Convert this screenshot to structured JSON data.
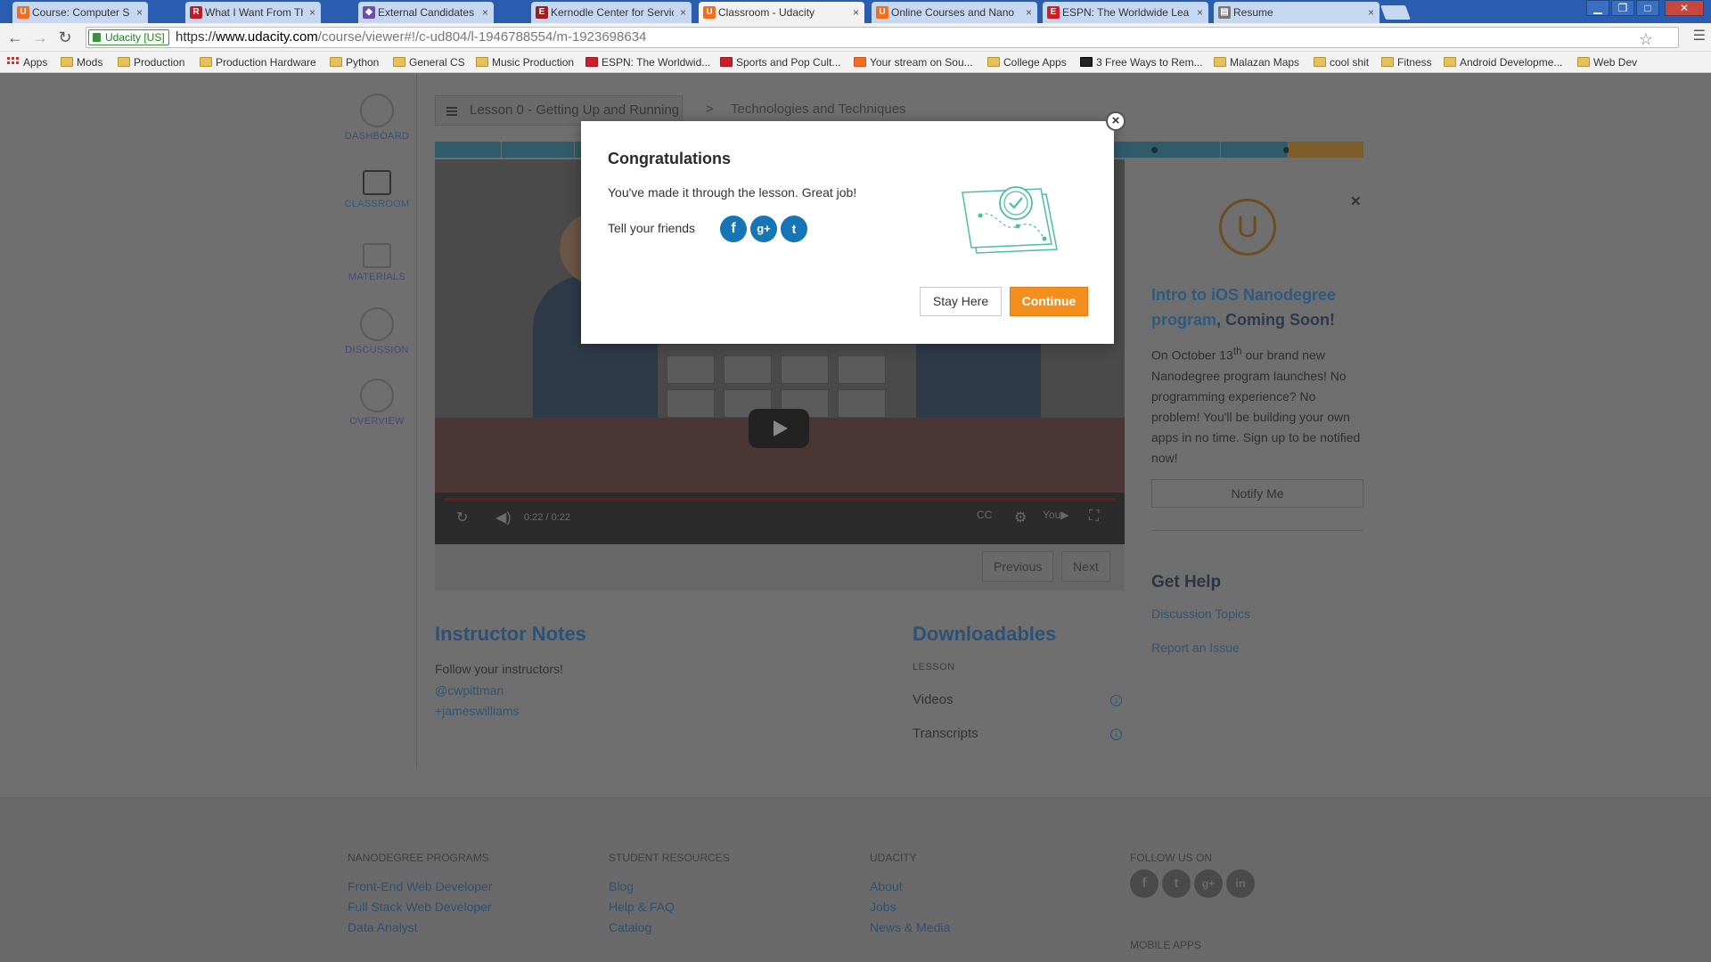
{
  "browser": {
    "tabs": [
      {
        "title": "Course: Computer Science",
        "favicon": "orange-u",
        "active": false
      },
      {
        "title": "What I Want From The Ne",
        "favicon": "red-r",
        "active": false
      },
      {
        "title": "External Candidates Gate",
        "favicon": "purple-diamond",
        "active": false
      },
      {
        "title": "Kernodle Center for Servic",
        "favicon": "e-letter",
        "active": false
      },
      {
        "title": "Classroom - Udacity",
        "favicon": "orange-u",
        "active": true
      },
      {
        "title": "Online Courses and Nano",
        "favicon": "orange-u",
        "active": false
      },
      {
        "title": "ESPN: The Worldwide Lea",
        "favicon": "espn",
        "active": false
      },
      {
        "title": "Resume",
        "favicon": "doc",
        "active": false
      }
    ],
    "security_label": "Udacity [US]",
    "url_scheme": "https://",
    "url_host": "www.udacity.com",
    "url_path": "/course/viewer#!/c-ud804/l-1946788554/m-1923698634",
    "bookmarks": [
      "Apps",
      "Mods",
      "Production",
      "Production Hardware",
      "Python",
      "General CS",
      "Music Production",
      "ESPN: The Worldwid...",
      "Sports and Pop Cult...",
      "Your stream on Sou...",
      "College Apps",
      "3 Free Ways to Rem...",
      "Malazan Maps",
      "cool shit",
      "Fitness",
      "Android Developme...",
      "Web Dev"
    ]
  },
  "leftnav": {
    "items": [
      {
        "label": "DASHBOARD",
        "icon": "dashboard-icon"
      },
      {
        "label": "CLASSROOM",
        "icon": "play-icon"
      },
      {
        "label": "MATERIALS",
        "icon": "document-icon"
      },
      {
        "label": "DISCUSSION",
        "icon": "chat-icon"
      },
      {
        "label": "OVERVIEW",
        "icon": "info-icon"
      }
    ]
  },
  "lesson": {
    "breadcrumb": "Lesson 0 - Getting Up and Running",
    "separator": ">",
    "current": "Technologies and Techniques"
  },
  "video": {
    "time": "0:22 / 0:22"
  },
  "pager": {
    "previous": "Previous",
    "next": "Next"
  },
  "instructor_notes": {
    "title": "Instructor Notes",
    "text": "Follow your instructors!",
    "links": [
      "@cwpittman",
      "+jameswilliams"
    ]
  },
  "downloadables": {
    "title": "Downloadables",
    "section": "LESSON",
    "items": [
      "Videos",
      "Transcripts"
    ]
  },
  "promo": {
    "highlight": "Intro to iOS Nanodegree program",
    "rest": ", Coming Soon!",
    "text_pre": "On October 13",
    "text_sup": "th",
    "text_post": " our brand new Nanodegree program launches! No programming experience? No problem! You'll be building your own apps in no time. Sign up to be notified now!",
    "button": "Notify Me"
  },
  "help": {
    "title": "Get Help",
    "links": [
      "Discussion Topics",
      "Report an Issue"
    ]
  },
  "footer": {
    "columns": [
      {
        "heading": "NANODEGREE PROGRAMS",
        "links": [
          "Front-End Web Developer",
          "Full Stack Web Developer",
          "Data Analyst"
        ]
      },
      {
        "heading": "STUDENT RESOURCES",
        "links": [
          "Blog",
          "Help & FAQ",
          "Catalog"
        ]
      },
      {
        "heading": "UDACITY",
        "links": [
          "About",
          "Jobs",
          "News & Media"
        ]
      },
      {
        "heading": "FOLLOW US ON",
        "links": []
      }
    ],
    "social": [
      "f",
      "t",
      "g+",
      "in"
    ],
    "mobile_heading": "MOBILE APPS"
  },
  "modal": {
    "title": "Congratulations",
    "message": "You've made it through the lesson. Great job!",
    "tell": "Tell your friends",
    "share": [
      "f",
      "g+",
      "t"
    ],
    "stay_label": "Stay Here",
    "continue_label": "Continue",
    "close": "×"
  },
  "colors": {
    "accent_orange": "#f28f1e",
    "share_blue": "#1575b5",
    "illustration_green": "#4bbf9f"
  }
}
